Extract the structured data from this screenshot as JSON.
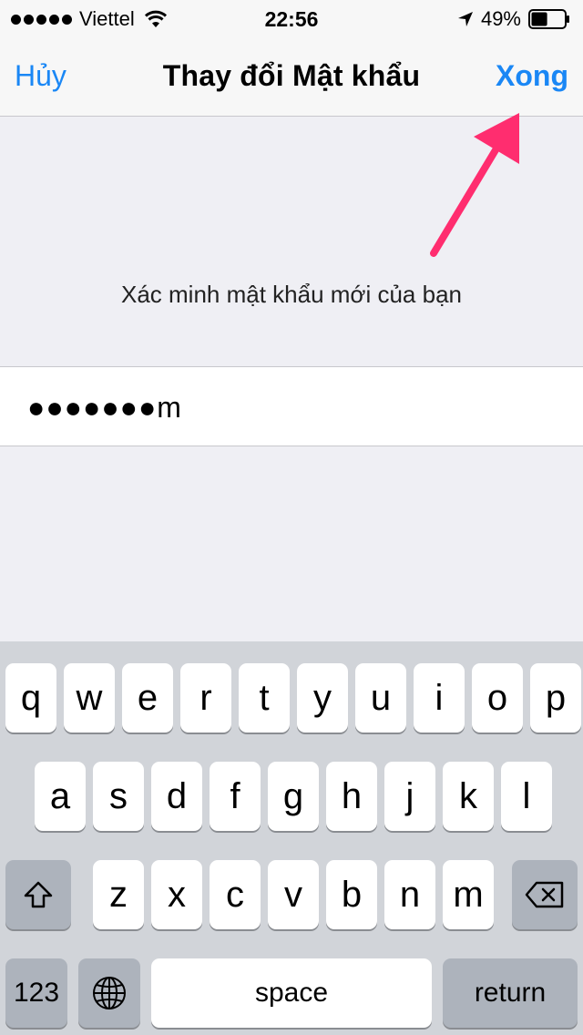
{
  "status_bar": {
    "carrier": "Viettel",
    "time": "22:56",
    "battery_percent": "49%",
    "battery_level": 0.49
  },
  "nav": {
    "cancel_label": "Hủy",
    "title": "Thay đổi Mật khẩu",
    "done_label": "Xong"
  },
  "form": {
    "prompt": "Xác minh mật khẩu mới của bạn",
    "password_value": "●●●●●●●m"
  },
  "annotation": {
    "color": "#ff2d6f"
  },
  "colors": {
    "accent": "#1a87f5",
    "background": "#efeff4"
  },
  "keyboard": {
    "row1": [
      "q",
      "w",
      "e",
      "r",
      "t",
      "y",
      "u",
      "i",
      "o",
      "p"
    ],
    "row2": [
      "a",
      "s",
      "d",
      "f",
      "g",
      "h",
      "j",
      "k",
      "l"
    ],
    "row3": [
      "z",
      "x",
      "c",
      "v",
      "b",
      "n",
      "m"
    ],
    "shift_icon": "shift-icon",
    "delete_icon": "delete-icon",
    "numbers_label": "123",
    "globe_icon": "globe-icon",
    "space_label": "space",
    "return_label": "return"
  }
}
